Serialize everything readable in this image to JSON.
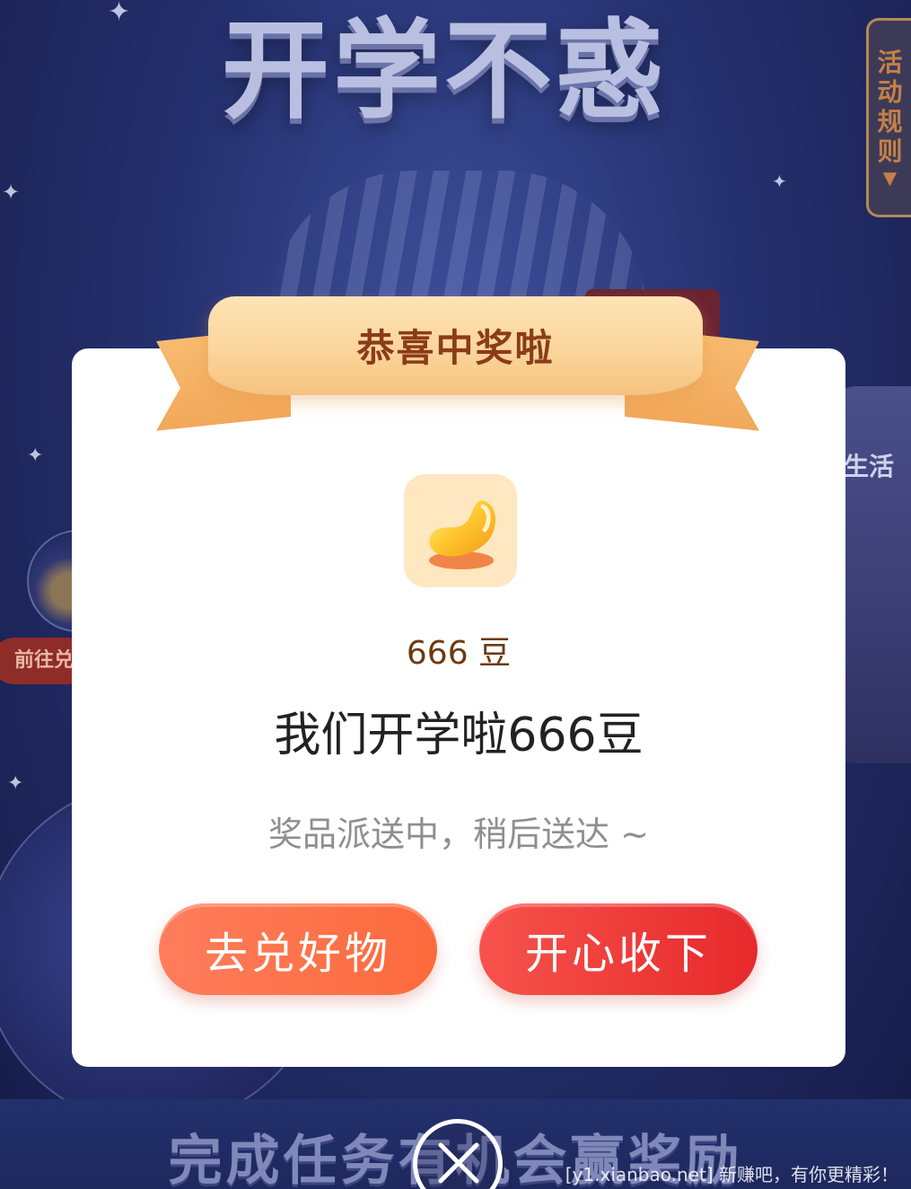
{
  "background": {
    "event_title": "开学不惑",
    "rules_tab": {
      "label_chars": [
        "活",
        "动",
        "规",
        "则"
      ],
      "arrow": "▼"
    },
    "left_button_label": "前往兑",
    "right_card_text": "生活",
    "bottom_banner_text": "完成任务有机会赢奖励"
  },
  "modal": {
    "ribbon_title": "恭喜中奖啦",
    "prize_icon": "golden-bean-icon",
    "prize_amount": "666 豆",
    "prize_name": "我们开学啦666豆",
    "status_text": "奖品派送中，稍后送达 ~",
    "buttons": {
      "redeem_label": "去兑好物",
      "accept_label": "开心收下"
    }
  },
  "close_icon": "close-icon",
  "watermark_text": "[y1.xianbao.net] 新赚吧，有你更精彩！",
  "colors": {
    "ribbon_text": "#8b3b18",
    "redeem_button": "#fb6a3c",
    "accept_button": "#e7292c",
    "bean_tile": "#ffe7c1"
  }
}
